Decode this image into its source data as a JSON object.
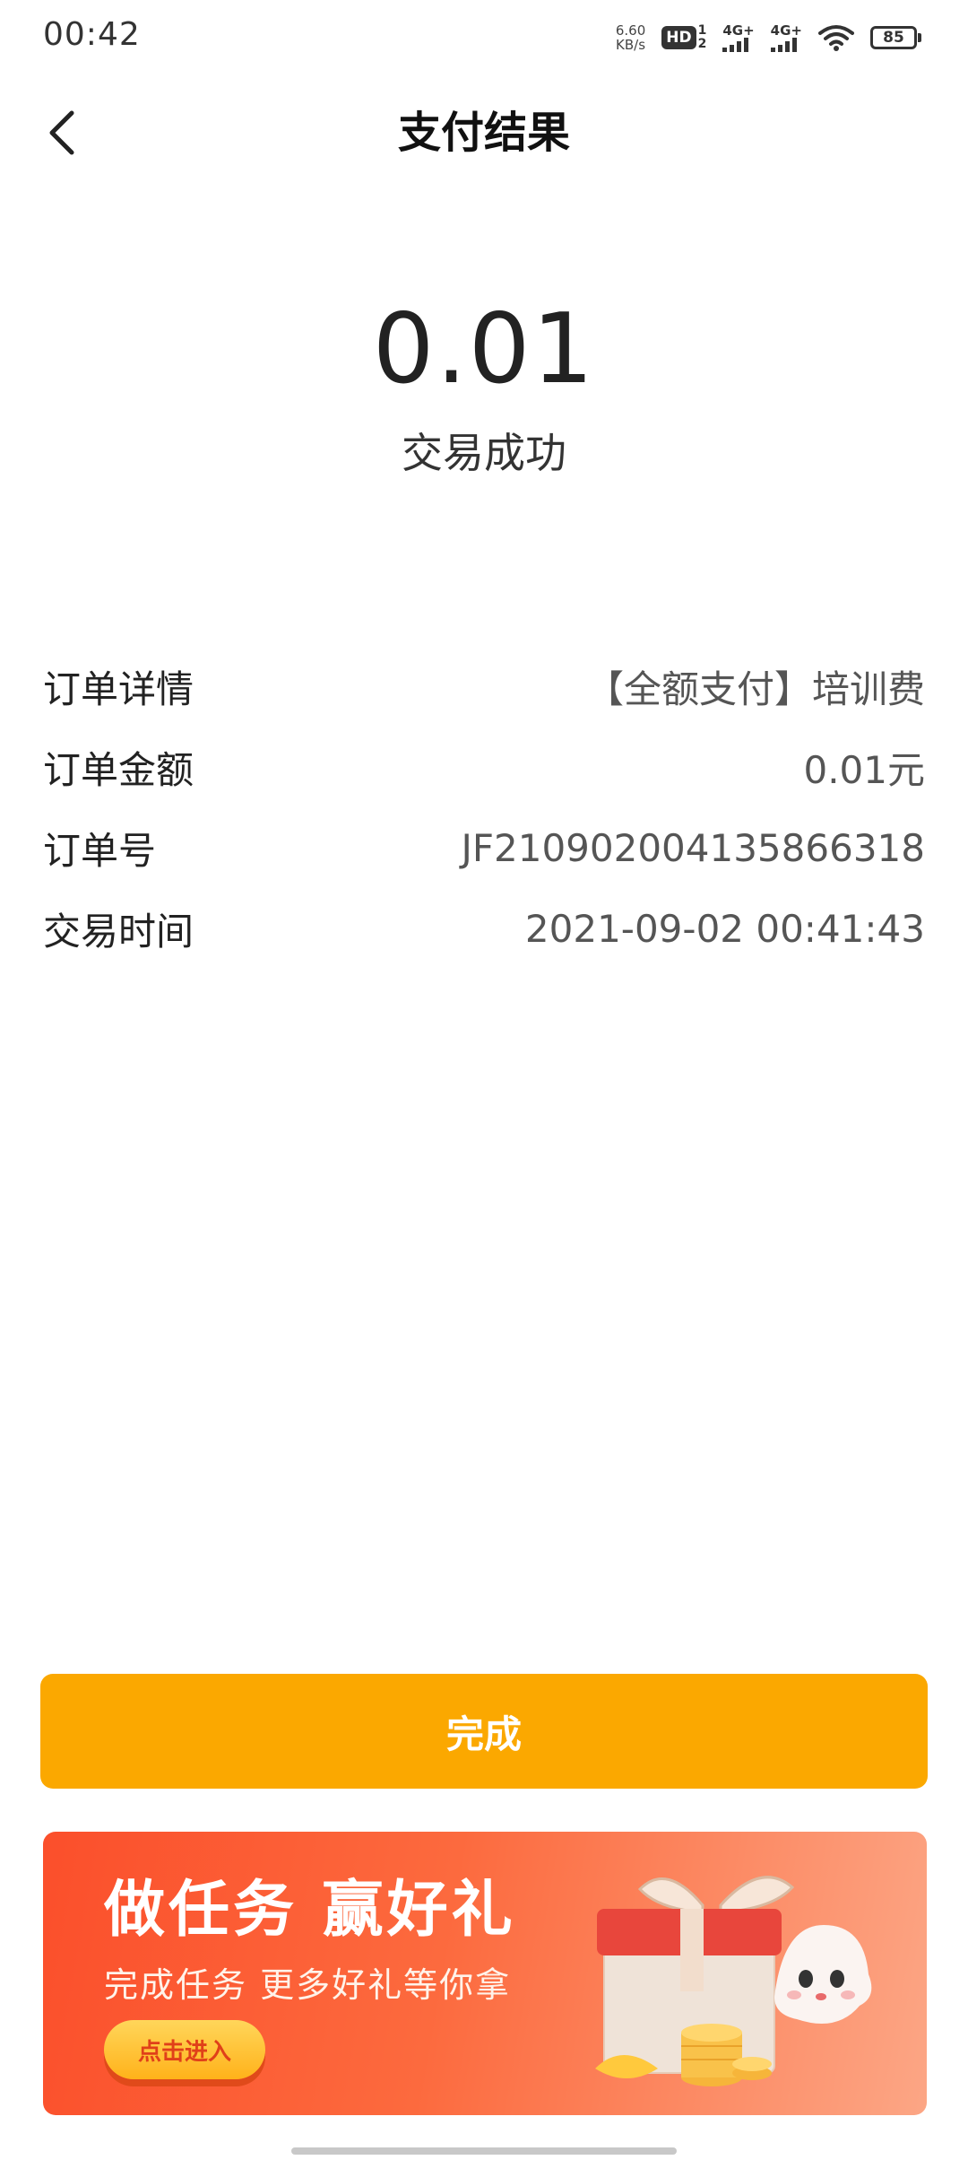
{
  "status_bar": {
    "time": "00:42",
    "net_speed_value": "6.60",
    "net_speed_unit": "KB/s",
    "hd_label": "HD",
    "hd_sim_top": "1",
    "hd_sim_bottom": "2",
    "signal1_label": "4G+",
    "signal2_label": "4G+",
    "battery_level": "85"
  },
  "header": {
    "title": "支付结果",
    "back_icon": "chevron-left-icon"
  },
  "result": {
    "amount": "0.01",
    "status_text": "交易成功"
  },
  "details": [
    {
      "label": "订单详情",
      "value": "【全额支付】培训费"
    },
    {
      "label": "订单金额",
      "value": "0.01元"
    },
    {
      "label": "订单号",
      "value": "JF2109020041358663​18"
    },
    {
      "label": "交易时间",
      "value": "2021-09-02 00:41:43"
    }
  ],
  "done_button": {
    "label": "完成",
    "color": "#fba800"
  },
  "banner": {
    "title": "做任务 赢好礼",
    "subtitle": "完成任务 更多好礼等你拿",
    "cta_label": "点击进入"
  }
}
